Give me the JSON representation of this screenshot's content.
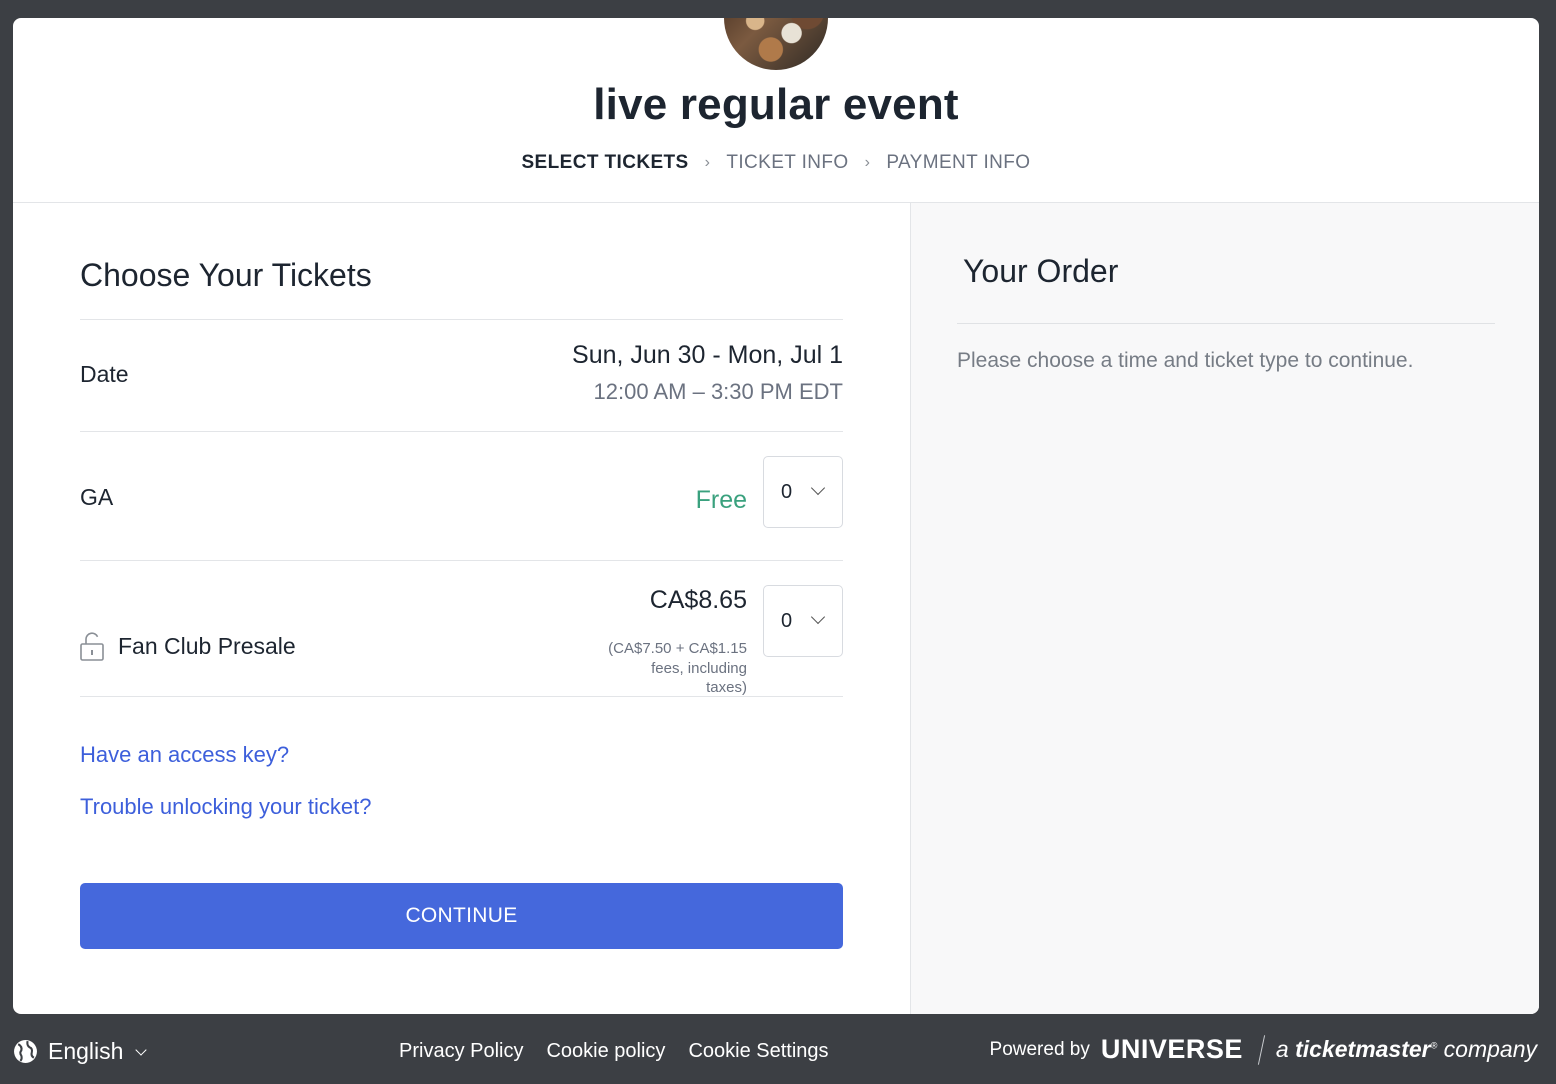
{
  "header": {
    "event_title": "live regular event",
    "steps": [
      {
        "label": "SELECT TICKETS",
        "active": true
      },
      {
        "label": "TICKET INFO",
        "active": false
      },
      {
        "label": "PAYMENT INFO",
        "active": false
      }
    ]
  },
  "tickets": {
    "title": "Choose Your Tickets",
    "date_label": "Date",
    "date_range": "Sun, Jun 30 - Mon, Jul 1",
    "time_range": "12:00 AM – 3:30 PM EDT",
    "items": [
      {
        "name": "GA",
        "price": "Free",
        "quantity": "0"
      },
      {
        "name": "Fan Club Presale",
        "price": "CA$8.65",
        "price_note": "(CA$7.50 + CA$1.15 fees, including taxes)",
        "quantity": "0",
        "icon": "lock-icon"
      }
    ],
    "access_key_link": "Have an access key?",
    "trouble_link": "Trouble unlocking your ticket?",
    "continue_label": "CONTINUE"
  },
  "order": {
    "title": "Your Order",
    "message": "Please choose a time and ticket type to continue."
  },
  "footer": {
    "language": "English",
    "links": [
      "Privacy Policy",
      "Cookie policy",
      "Cookie Settings"
    ],
    "powered_by": "Powered by",
    "brand": "UNIVERSE",
    "tm_prefix": "a",
    "tm_brand": "ticketmaster",
    "tm_mark": "®",
    "tm_suffix": "company"
  },
  "colors": {
    "accent": "#4568dc",
    "link": "#3d5fdb",
    "free": "#3aa17e",
    "background": "#3c3f44"
  }
}
